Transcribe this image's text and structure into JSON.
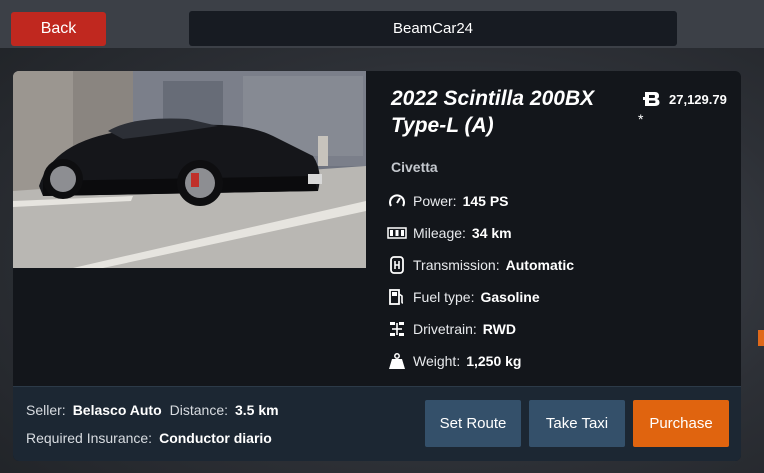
{
  "header": {
    "back_label": "Back",
    "title": "BeamCar24"
  },
  "listing": {
    "title": "2022 Scintilla 200BX Type-L (A)",
    "brand": "Civetta",
    "price": "27,129.79",
    "price_note": "*",
    "specs": [
      {
        "icon": "speedometer-icon",
        "label": "Power:",
        "value": "145 PS"
      },
      {
        "icon": "odometer-icon",
        "label": "Mileage:",
        "value": "34 km"
      },
      {
        "icon": "gearbox-icon",
        "label": "Transmission:",
        "value": "Automatic"
      },
      {
        "icon": "fuel-pump-icon",
        "label": "Fuel type:",
        "value": "Gasoline"
      },
      {
        "icon": "drivetrain-icon",
        "label": "Drivetrain:",
        "value": "RWD"
      },
      {
        "icon": "weight-icon",
        "label": "Weight:",
        "value": "1,250 kg"
      }
    ]
  },
  "footer": {
    "seller_label": "Seller:",
    "seller": "Belasco Auto",
    "distance_label": "Distance:",
    "distance": "3.5 km",
    "insurance_label": "Required Insurance:",
    "insurance": "Conductor diario",
    "buttons": {
      "route": "Set Route",
      "taxi": "Take Taxi",
      "purchase": "Purchase"
    }
  },
  "colors": {
    "back": "#c0281f",
    "purchase": "#e0640f",
    "secondary": "#34506a",
    "card": "#13161b"
  }
}
